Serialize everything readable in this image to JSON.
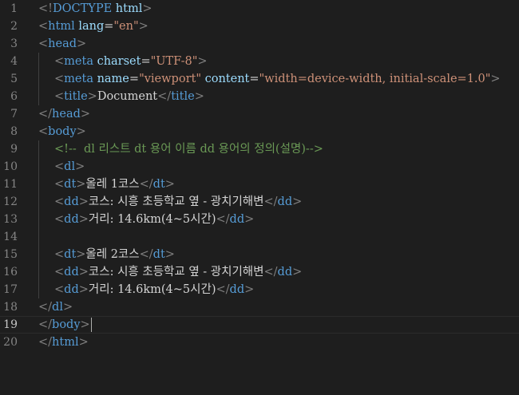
{
  "editor": {
    "language": "html",
    "active_line": 19,
    "colors": {
      "background": "#1e1e1e",
      "line_number": "#858585",
      "tag": "#569cd6",
      "attribute": "#9cdcfe",
      "string": "#ce9178",
      "comment": "#6a9955",
      "text": "#d4d4d4",
      "punctuation": "#808080"
    },
    "lines": [
      {
        "num": "1",
        "indent": 0,
        "tokens": [
          [
            "punc",
            "<!"
          ],
          [
            "tag",
            "DOCTYPE"
          ],
          [
            "txt",
            " "
          ],
          [
            "attr",
            "html"
          ],
          [
            "punc",
            ">"
          ]
        ]
      },
      {
        "num": "2",
        "indent": 0,
        "tokens": [
          [
            "punc",
            "<"
          ],
          [
            "tag",
            "html"
          ],
          [
            "txt",
            " "
          ],
          [
            "attr",
            "lang"
          ],
          [
            "txt",
            "="
          ],
          [
            "str",
            "\"en\""
          ],
          [
            "punc",
            ">"
          ]
        ]
      },
      {
        "num": "3",
        "indent": 0,
        "tokens": [
          [
            "punc",
            "<"
          ],
          [
            "tag",
            "head"
          ],
          [
            "punc",
            ">"
          ]
        ]
      },
      {
        "num": "4",
        "indent": 1,
        "tokens": [
          [
            "punc",
            "<"
          ],
          [
            "tag",
            "meta"
          ],
          [
            "txt",
            " "
          ],
          [
            "attr",
            "charset"
          ],
          [
            "txt",
            "="
          ],
          [
            "str",
            "\"UTF-8\""
          ],
          [
            "punc",
            ">"
          ]
        ]
      },
      {
        "num": "5",
        "indent": 1,
        "tokens": [
          [
            "punc",
            "<"
          ],
          [
            "tag",
            "meta"
          ],
          [
            "txt",
            " "
          ],
          [
            "attr",
            "name"
          ],
          [
            "txt",
            "="
          ],
          [
            "str",
            "\"viewport\""
          ],
          [
            "txt",
            " "
          ],
          [
            "attr",
            "content"
          ],
          [
            "txt",
            "="
          ],
          [
            "str",
            "\"width=device-width, initial-scale=1.0\""
          ],
          [
            "punc",
            ">"
          ]
        ]
      },
      {
        "num": "6",
        "indent": 1,
        "tokens": [
          [
            "punc",
            "<"
          ],
          [
            "tag",
            "title"
          ],
          [
            "punc",
            ">"
          ],
          [
            "txt",
            "Document"
          ],
          [
            "punc",
            "</"
          ],
          [
            "tag",
            "title"
          ],
          [
            "punc",
            ">"
          ]
        ]
      },
      {
        "num": "7",
        "indent": 0,
        "tokens": [
          [
            "punc",
            "</"
          ],
          [
            "tag",
            "head"
          ],
          [
            "punc",
            ">"
          ]
        ]
      },
      {
        "num": "8",
        "indent": 0,
        "tokens": [
          [
            "punc",
            "<"
          ],
          [
            "tag",
            "body"
          ],
          [
            "punc",
            ">"
          ]
        ]
      },
      {
        "num": "9",
        "indent": 1,
        "tokens": [
          [
            "cmt",
            "<!--  dl 리스트 dt 용어 이름 dd 용어의 정의(설명)-->"
          ]
        ]
      },
      {
        "num": "10",
        "indent": 1,
        "tokens": [
          [
            "punc",
            "<"
          ],
          [
            "tag",
            "dl"
          ],
          [
            "punc",
            ">"
          ]
        ]
      },
      {
        "num": "11",
        "indent": 1,
        "tokens": [
          [
            "punc",
            "<"
          ],
          [
            "tag",
            "dt"
          ],
          [
            "punc",
            ">"
          ],
          [
            "txt",
            "올레 1코스"
          ],
          [
            "punc",
            "</"
          ],
          [
            "tag",
            "dt"
          ],
          [
            "punc",
            ">"
          ]
        ]
      },
      {
        "num": "12",
        "indent": 1,
        "tokens": [
          [
            "punc",
            "<"
          ],
          [
            "tag",
            "dd"
          ],
          [
            "punc",
            ">"
          ],
          [
            "txt",
            "코스: 시흥 초등학교 옆 - 광치기해변"
          ],
          [
            "punc",
            "</"
          ],
          [
            "tag",
            "dd"
          ],
          [
            "punc",
            ">"
          ]
        ]
      },
      {
        "num": "13",
        "indent": 1,
        "tokens": [
          [
            "punc",
            "<"
          ],
          [
            "tag",
            "dd"
          ],
          [
            "punc",
            ">"
          ],
          [
            "txt",
            "거리: 14.6km(4~5시간)"
          ],
          [
            "punc",
            "</"
          ],
          [
            "tag",
            "dd"
          ],
          [
            "punc",
            ">"
          ]
        ]
      },
      {
        "num": "14",
        "indent": 1,
        "tokens": []
      },
      {
        "num": "15",
        "indent": 1,
        "tokens": [
          [
            "punc",
            "<"
          ],
          [
            "tag",
            "dt"
          ],
          [
            "punc",
            ">"
          ],
          [
            "txt",
            "올레 2코스"
          ],
          [
            "punc",
            "</"
          ],
          [
            "tag",
            "dt"
          ],
          [
            "punc",
            ">"
          ]
        ]
      },
      {
        "num": "16",
        "indent": 1,
        "tokens": [
          [
            "punc",
            "<"
          ],
          [
            "tag",
            "dd"
          ],
          [
            "punc",
            ">"
          ],
          [
            "txt",
            "코스: 시흥 초등학교 옆 - 광치기해변"
          ],
          [
            "punc",
            "</"
          ],
          [
            "tag",
            "dd"
          ],
          [
            "punc",
            ">"
          ]
        ]
      },
      {
        "num": "17",
        "indent": 1,
        "tokens": [
          [
            "punc",
            "<"
          ],
          [
            "tag",
            "dd"
          ],
          [
            "punc",
            ">"
          ],
          [
            "txt",
            "거리: 14.6km(4~5시간)"
          ],
          [
            "punc",
            "</"
          ],
          [
            "tag",
            "dd"
          ],
          [
            "punc",
            ">"
          ]
        ]
      },
      {
        "num": "18",
        "indent": 0,
        "tokens": [
          [
            "punc",
            "</"
          ],
          [
            "tag",
            "dl"
          ],
          [
            "punc",
            ">"
          ]
        ]
      },
      {
        "num": "19",
        "indent": 0,
        "tokens": [
          [
            "punc",
            "</"
          ],
          [
            "tag",
            "body"
          ],
          [
            "punc",
            ">"
          ]
        ]
      },
      {
        "num": "20",
        "indent": 0,
        "tokens": [
          [
            "punc",
            "</"
          ],
          [
            "tag",
            "html"
          ],
          [
            "punc",
            ">"
          ]
        ]
      }
    ]
  }
}
